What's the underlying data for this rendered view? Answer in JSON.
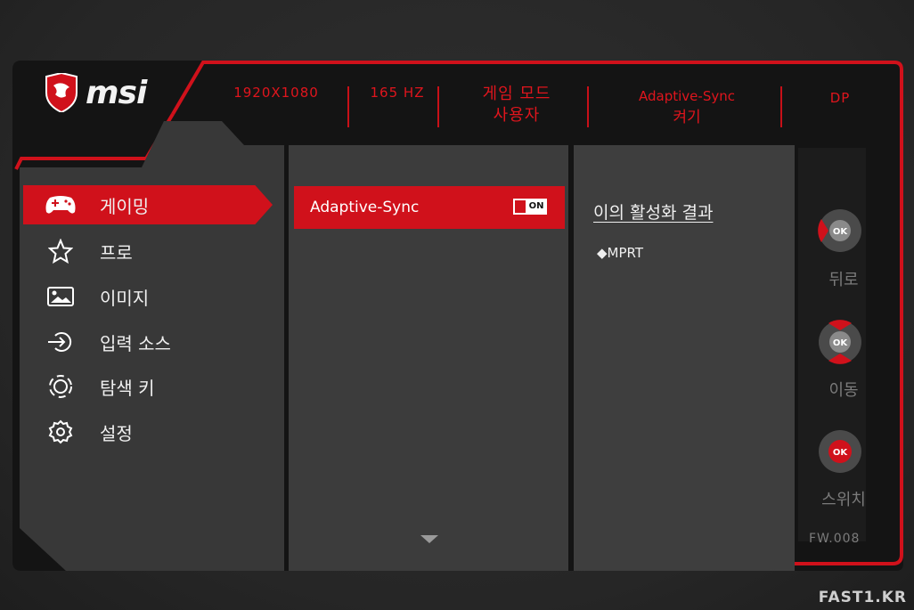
{
  "brand": {
    "logo_text": "msi"
  },
  "status_bar": {
    "resolution": "1920X1080",
    "refresh_rate": "165 HZ",
    "game_mode_line1": "게임 모드",
    "game_mode_line2": "사용자",
    "adaptive_sync_line1": "Adaptive-Sync",
    "adaptive_sync_line2": "켜기",
    "input": "DP"
  },
  "menu": {
    "items": [
      {
        "label": "게이밍",
        "icon": "gamepad-icon",
        "active": true
      },
      {
        "label": "프로",
        "icon": "star-icon",
        "active": false
      },
      {
        "label": "이미지",
        "icon": "image-icon",
        "active": false
      },
      {
        "label": "입력 소스",
        "icon": "input-source-icon",
        "active": false
      },
      {
        "label": "탐색 키",
        "icon": "navigation-key-icon",
        "active": false
      },
      {
        "label": "설정",
        "icon": "gear-icon",
        "active": false
      }
    ]
  },
  "submenu": {
    "item_label": "Adaptive-Sync",
    "toggle_label": "ON"
  },
  "info": {
    "title": "이의 활성화 결과",
    "items": [
      "MPRT"
    ]
  },
  "controls": {
    "back_label": "뒤로",
    "move_label": "이동",
    "switch_label": "스위치",
    "ok_text": "OK",
    "firmware": "FW.008"
  },
  "colors": {
    "accent": "#d0111b",
    "panel": "#3a3a3a",
    "text": "#efefef"
  },
  "watermark": "FAST1.KR"
}
